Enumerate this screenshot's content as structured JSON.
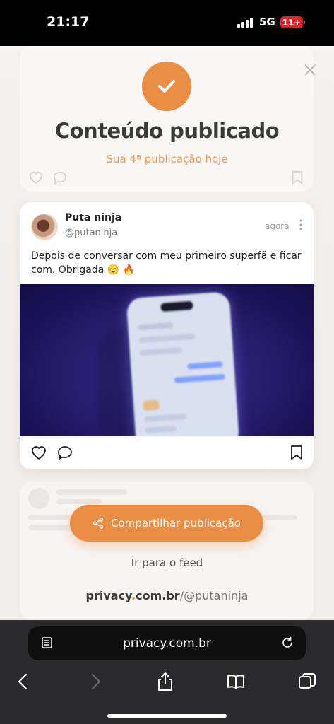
{
  "status_bar": {
    "time": "21:17",
    "network": "5G",
    "battery": "11+"
  },
  "modal": {
    "title": "Conteúdo publicado",
    "subtitle": "Sua 4ª publicação hoje",
    "close_icon": "close-icon",
    "success_icon": "check-icon"
  },
  "post": {
    "author_name": "Puta ninja",
    "author_handle": "@putaninja",
    "time_ago": "agora",
    "more_icon": "more-vertical-icon",
    "text": "Depois de conversar com meu primeiro superfã e ficar com. Obrigada ☺️ 🔥",
    "actions": {
      "like_icon": "heart-icon",
      "comment_icon": "comment-icon",
      "bookmark_icon": "bookmark-icon"
    }
  },
  "buttons": {
    "share_label": "Compartilhar publicação",
    "share_icon": "share-icon",
    "feed_label": "Ir para o feed"
  },
  "footer_domain": {
    "site_a": "privacy",
    "dot": ".",
    "site_b": "com.br",
    "handle": "/@putaninja"
  },
  "browser": {
    "url": "privacy.com.br",
    "reader_icon": "reader-icon",
    "reload_icon": "reload-icon",
    "nav": [
      "back-icon",
      "forward-icon",
      "share-icon",
      "bookmarks-icon",
      "tabs-icon"
    ]
  },
  "colors": {
    "accent": "#ea8d45",
    "subtitle": "#ec9a55",
    "title": "#3a3a3a",
    "battery_low": "#d9252c"
  }
}
